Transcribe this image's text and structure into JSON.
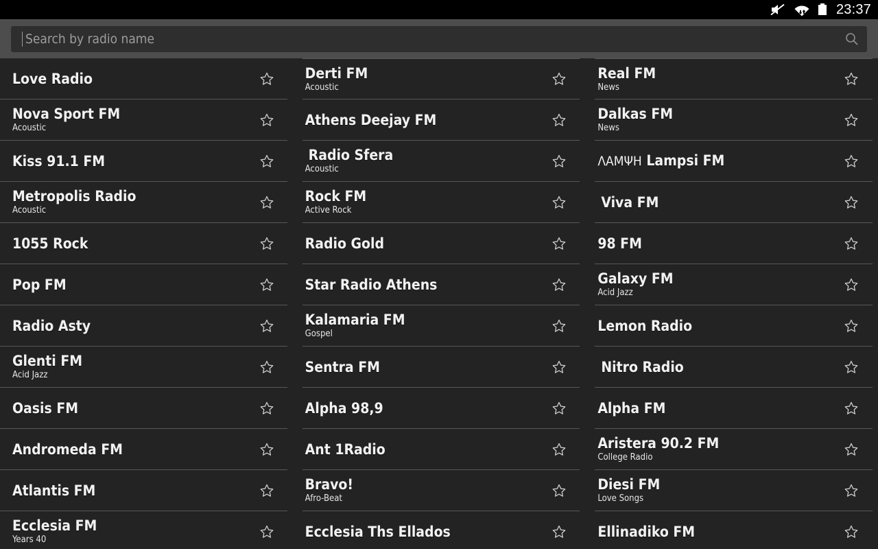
{
  "statusbar": {
    "time": "23:37",
    "icons": [
      "volume-mute-icon",
      "wifi-icon",
      "battery-icon"
    ]
  },
  "search": {
    "placeholder": "Search by radio name",
    "value": "",
    "icon": "search-icon"
  },
  "colors": {
    "status_bg": "#000000",
    "search_band_bg": "#4d4d4d",
    "search_field_bg": "#2e2e2e",
    "list_bg": "#232323",
    "divider": "#585858",
    "title_text": "#f2f2f2",
    "sub_text": "#e6e6e6",
    "placeholder_text": "#9d9d9d"
  },
  "list": {
    "favorite_icon": "star-outline-icon",
    "columns": [
      {
        "id": "column-1",
        "top_divider": false,
        "items": [
          {
            "name": "Love Radio",
            "genre": ""
          },
          {
            "name": "Nova Sport FM",
            "genre": "Acoustic"
          },
          {
            "name": "Kiss 91.1 FM",
            "genre": ""
          },
          {
            "name": "Metropolis Radio",
            "genre": "Acoustic"
          },
          {
            "name": "1055 Rock",
            "genre": ""
          },
          {
            "name": "Pop FM",
            "genre": ""
          },
          {
            "name": "Radio Asty",
            "genre": ""
          },
          {
            "name": "Glenti FM",
            "genre": "Acid Jazz"
          },
          {
            "name": "Oasis FM",
            "genre": ""
          },
          {
            "name": "Andromeda FM",
            "genre": ""
          },
          {
            "name": "Atlantis FM",
            "genre": ""
          },
          {
            "name": "Ecclesia FM",
            "genre": "Years 40"
          }
        ]
      },
      {
        "id": "column-2",
        "top_divider": true,
        "items": [
          {
            "name": "Derti FM",
            "genre": "Acoustic"
          },
          {
            "name": "Athens Deejay FM",
            "genre": ""
          },
          {
            "name": "Radio Sfera",
            "genre": "Acoustic",
            "indent": true
          },
          {
            "name": "Rock FM",
            "genre": "Active Rock"
          },
          {
            "name": "Radio Gold",
            "genre": ""
          },
          {
            "name": "Star Radio Athens",
            "genre": ""
          },
          {
            "name": "Kalamaria FM",
            "genre": "Gospel"
          },
          {
            "name": "Sentra FM",
            "genre": ""
          },
          {
            "name": "Alpha 98,9",
            "genre": ""
          },
          {
            "name": "Ant 1Radio",
            "genre": ""
          },
          {
            "name": "Bravo!",
            "genre": "Afro-Beat"
          },
          {
            "name": "Ecclesia Ths Ellados",
            "genre": ""
          }
        ]
      },
      {
        "id": "column-3",
        "top_divider": true,
        "items": [
          {
            "name": "Real FM",
            "genre": "News"
          },
          {
            "name": "Dalkas FM",
            "genre": "News"
          },
          {
            "name": "ΛΑΜΨΗ Lampsi FM",
            "genre": "",
            "greek_prefix": "ΛΑΜΨΗ",
            "rest": "Lampsi FM"
          },
          {
            "name": "Viva FM",
            "genre": "",
            "indent": true
          },
          {
            "name": "98 FM",
            "genre": ""
          },
          {
            "name": "Galaxy FM",
            "genre": "Acid Jazz"
          },
          {
            "name": "Lemon Radio",
            "genre": ""
          },
          {
            "name": "Nitro Radio",
            "genre": "",
            "indent": true
          },
          {
            "name": "Alpha FM",
            "genre": ""
          },
          {
            "name": "Aristera 90.2 FM",
            "genre": "College Radio"
          },
          {
            "name": "Diesi FM",
            "genre": "Love Songs"
          },
          {
            "name": "Ellinadiko FM",
            "genre": ""
          }
        ]
      }
    ]
  }
}
